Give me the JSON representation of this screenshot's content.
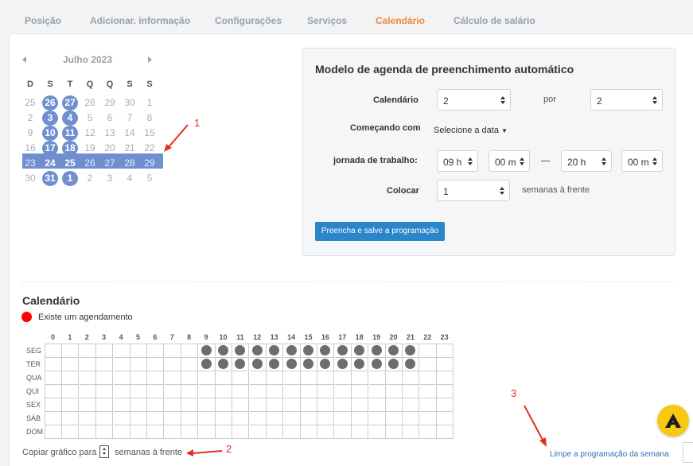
{
  "tabs": [
    "Posição",
    "Adicionar. informação",
    "Configurações",
    "Serviços",
    "Calendário",
    "Cálculo de salário"
  ],
  "mini_calendar": {
    "month": "Julho 2023",
    "weekdays": [
      "D",
      "S",
      "T",
      "Q",
      "Q",
      "S",
      "S"
    ],
    "weeks": [
      [
        "25",
        "26",
        "27",
        "28",
        "29",
        "30",
        "1"
      ],
      [
        "2",
        "3",
        "4",
        "5",
        "6",
        "7",
        "8"
      ],
      [
        "9",
        "10",
        "11",
        "12",
        "13",
        "14",
        "15"
      ],
      [
        "16",
        "17",
        "18",
        "19",
        "20",
        "21",
        "22"
      ],
      [
        "23",
        "24",
        "25",
        "26",
        "27",
        "28",
        "29"
      ],
      [
        "30",
        "31",
        "1",
        "2",
        "3",
        "4",
        "5"
      ]
    ]
  },
  "annotations": [
    "1",
    "2",
    "3"
  ],
  "form": {
    "title": "Modelo de agenda de preenchimento automático",
    "calendar_label": "Calendário",
    "calendar_value": "2",
    "por_label": "por",
    "por_value": "2",
    "start_label": "Começando com",
    "start_value": "Selecione a data",
    "workday_label": "jornada de trabalho:",
    "start_h": "09 h",
    "start_m": "00 m",
    "end_h": "20 h",
    "end_m": "00 m",
    "put_label": "Colocar",
    "put_value": "1",
    "weeks_ahead": "semanas à frente",
    "submit": "Preencha e salve a programação"
  },
  "schedule": {
    "title": "Calendário",
    "legend": "Existe um agendamento",
    "hours": [
      "0",
      "1",
      "2",
      "3",
      "4",
      "5",
      "6",
      "7",
      "8",
      "9",
      "10",
      "11",
      "12",
      "13",
      "14",
      "15",
      "16",
      "17",
      "18",
      "19",
      "20",
      "21",
      "22",
      "23"
    ],
    "days": [
      "SEG",
      "TER",
      "QUA",
      "QUI",
      "SEX",
      "SÁB",
      "DOM"
    ],
    "copy_prefix": "Copiar gráfico para",
    "copy_suffix": "semanas à frente",
    "clear": "Limpe a programação da semana"
  }
}
